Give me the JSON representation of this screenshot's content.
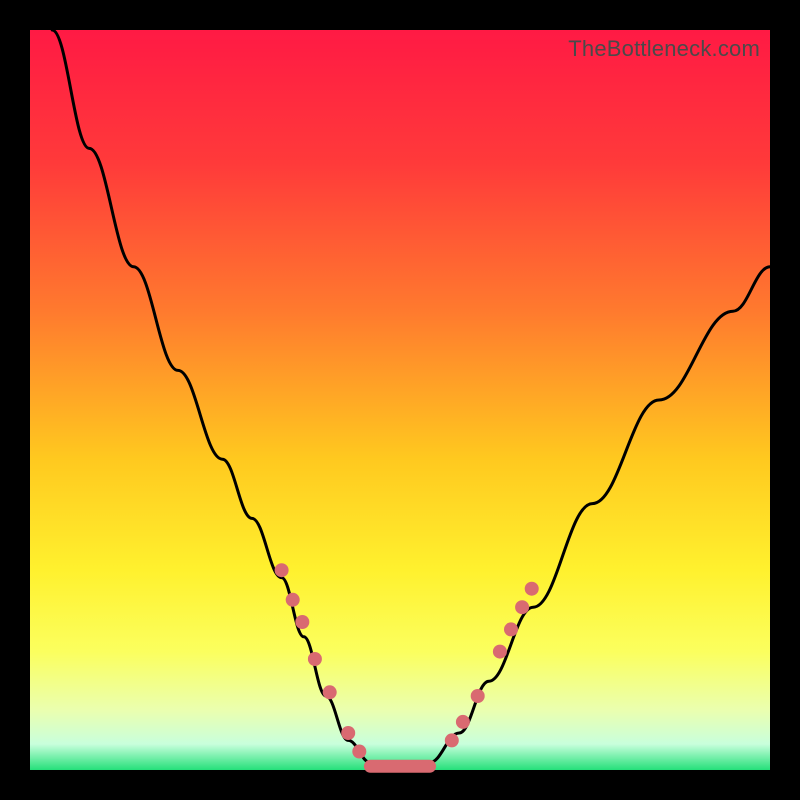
{
  "watermark": "TheBottleneck.com",
  "colors": {
    "gradient": [
      "#ff1a44",
      "#ff3a3a",
      "#ff7a2e",
      "#ffc91f",
      "#fff12e",
      "#fbff5e",
      "#eaffb0",
      "#c8ffdc",
      "#25e07a"
    ],
    "marker": "#d96a71",
    "curve": "#000000"
  },
  "chart_data": {
    "type": "line",
    "title": "",
    "xlabel": "",
    "ylabel": "",
    "xlim": [
      0,
      100
    ],
    "ylim": [
      0,
      100
    ],
    "grid": false,
    "legend": "none",
    "series": [
      {
        "name": "bottleneck-curve",
        "x": [
          3,
          8,
          14,
          20,
          26,
          30,
          34,
          37,
          40,
          43,
          46,
          50,
          54,
          58,
          62,
          68,
          76,
          85,
          95,
          100
        ],
        "values": [
          100,
          84,
          68,
          54,
          42,
          34,
          26,
          18,
          10,
          4,
          1,
          0.5,
          1,
          5,
          12,
          22,
          36,
          50,
          62,
          68
        ]
      }
    ],
    "plateau_range_x": [
      46,
      54
    ],
    "marker_points": [
      {
        "x": 34.0,
        "y": 27.0
      },
      {
        "x": 35.5,
        "y": 23.0
      },
      {
        "x": 36.8,
        "y": 20.0
      },
      {
        "x": 38.5,
        "y": 15.0
      },
      {
        "x": 40.5,
        "y": 10.5
      },
      {
        "x": 43.0,
        "y": 5.0
      },
      {
        "x": 44.5,
        "y": 2.5
      },
      {
        "x": 57.0,
        "y": 4.0
      },
      {
        "x": 58.5,
        "y": 6.5
      },
      {
        "x": 60.5,
        "y": 10.0
      },
      {
        "x": 63.5,
        "y": 16.0
      },
      {
        "x": 65.0,
        "y": 19.0
      },
      {
        "x": 66.5,
        "y": 22.0
      },
      {
        "x": 67.8,
        "y": 24.5
      }
    ]
  }
}
